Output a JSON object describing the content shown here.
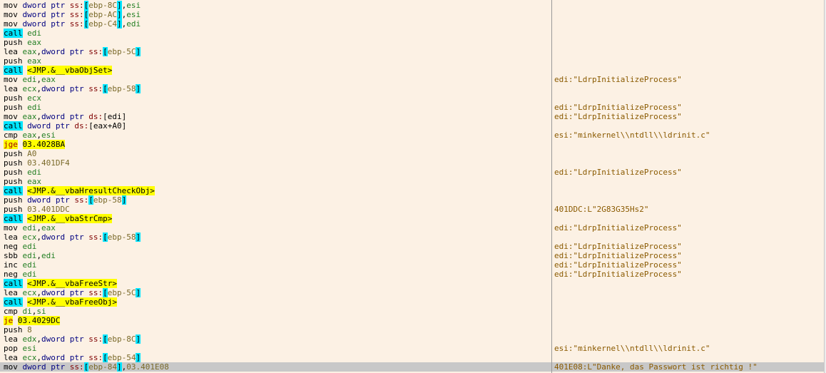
{
  "rows": [
    {
      "tokens": [
        {
          "t": "mov ",
          "k": "default"
        },
        {
          "t": "dword ptr ",
          "k": "size"
        },
        {
          "t": "ss:",
          "k": "segment"
        },
        {
          "t": "[",
          "k": "bracket"
        },
        {
          "t": "ebp-8C",
          "k": "immediate"
        },
        {
          "t": "]",
          "k": "bracket"
        },
        {
          "t": ",",
          "k": "default"
        },
        {
          "t": "esi",
          "k": "register"
        }
      ],
      "comment": ""
    },
    {
      "tokens": [
        {
          "t": "mov ",
          "k": "default"
        },
        {
          "t": "dword ptr ",
          "k": "size"
        },
        {
          "t": "ss:",
          "k": "segment"
        },
        {
          "t": "[",
          "k": "bracket"
        },
        {
          "t": "ebp-AC",
          "k": "immediate"
        },
        {
          "t": "]",
          "k": "bracket"
        },
        {
          "t": ",",
          "k": "default"
        },
        {
          "t": "esi",
          "k": "register"
        }
      ],
      "comment": ""
    },
    {
      "tokens": [
        {
          "t": "mov ",
          "k": "default"
        },
        {
          "t": "dword ptr ",
          "k": "size"
        },
        {
          "t": "ss:",
          "k": "segment"
        },
        {
          "t": "[",
          "k": "bracket"
        },
        {
          "t": "ebp-C4",
          "k": "immediate"
        },
        {
          "t": "]",
          "k": "bracket"
        },
        {
          "t": ",",
          "k": "default"
        },
        {
          "t": "edi",
          "k": "register"
        }
      ],
      "comment": ""
    },
    {
      "tokens": [
        {
          "t": "call",
          "k": "call"
        },
        {
          "t": " ",
          "k": "default"
        },
        {
          "t": "edi",
          "k": "register"
        }
      ],
      "comment": ""
    },
    {
      "tokens": [
        {
          "t": "push ",
          "k": "default"
        },
        {
          "t": "eax",
          "k": "register"
        }
      ],
      "comment": ""
    },
    {
      "tokens": [
        {
          "t": "lea ",
          "k": "default"
        },
        {
          "t": "eax",
          "k": "register"
        },
        {
          "t": ",",
          "k": "default"
        },
        {
          "t": "dword ptr ",
          "k": "size"
        },
        {
          "t": "ss:",
          "k": "segment"
        },
        {
          "t": "[",
          "k": "bracket"
        },
        {
          "t": "ebp-5C",
          "k": "immediate"
        },
        {
          "t": "]",
          "k": "bracket"
        }
      ],
      "comment": ""
    },
    {
      "tokens": [
        {
          "t": "push ",
          "k": "default"
        },
        {
          "t": "eax",
          "k": "register"
        }
      ],
      "comment": ""
    },
    {
      "tokens": [
        {
          "t": "call",
          "k": "call"
        },
        {
          "t": " ",
          "k": "default"
        },
        {
          "t": "<JMP.&__vbaObjSet>",
          "k": "target"
        }
      ],
      "comment": ""
    },
    {
      "tokens": [
        {
          "t": "mov ",
          "k": "default"
        },
        {
          "t": "edi",
          "k": "register"
        },
        {
          "t": ",",
          "k": "default"
        },
        {
          "t": "eax",
          "k": "register"
        }
      ],
      "comment": "edi:\"LdrpInitializeProcess\""
    },
    {
      "tokens": [
        {
          "t": "lea ",
          "k": "default"
        },
        {
          "t": "ecx",
          "k": "register"
        },
        {
          "t": ",",
          "k": "default"
        },
        {
          "t": "dword ptr ",
          "k": "size"
        },
        {
          "t": "ss:",
          "k": "segment"
        },
        {
          "t": "[",
          "k": "bracket"
        },
        {
          "t": "ebp-58",
          "k": "immediate"
        },
        {
          "t": "]",
          "k": "bracket"
        }
      ],
      "comment": ""
    },
    {
      "tokens": [
        {
          "t": "push ",
          "k": "default"
        },
        {
          "t": "ecx",
          "k": "register"
        }
      ],
      "comment": ""
    },
    {
      "tokens": [
        {
          "t": "push ",
          "k": "default"
        },
        {
          "t": "edi",
          "k": "register"
        }
      ],
      "comment": "edi:\"LdrpInitializeProcess\""
    },
    {
      "tokens": [
        {
          "t": "mov ",
          "k": "default"
        },
        {
          "t": "eax",
          "k": "register"
        },
        {
          "t": ",",
          "k": "default"
        },
        {
          "t": "dword ptr ",
          "k": "size"
        },
        {
          "t": "ds:",
          "k": "segment"
        },
        {
          "t": "[edi]",
          "k": "default"
        }
      ],
      "comment": "edi:\"LdrpInitializeProcess\""
    },
    {
      "tokens": [
        {
          "t": "call",
          "k": "call"
        },
        {
          "t": " ",
          "k": "default"
        },
        {
          "t": "dword ptr ",
          "k": "size"
        },
        {
          "t": "ds:",
          "k": "segment"
        },
        {
          "t": "[eax+A0]",
          "k": "default"
        }
      ],
      "comment": ""
    },
    {
      "tokens": [
        {
          "t": "cmp ",
          "k": "default"
        },
        {
          "t": "eax",
          "k": "register"
        },
        {
          "t": ",",
          "k": "default"
        },
        {
          "t": "esi",
          "k": "register"
        }
      ],
      "comment": "esi:\"minkernel\\\\ntdll\\\\ldrinit.c\""
    },
    {
      "tokens": [
        {
          "t": "jge",
          "k": "jump"
        },
        {
          "t": " ",
          "k": "default"
        },
        {
          "t": "03.4028BA",
          "k": "target"
        }
      ],
      "comment": ""
    },
    {
      "tokens": [
        {
          "t": "push ",
          "k": "default"
        },
        {
          "t": "A0",
          "k": "immediate"
        }
      ],
      "comment": ""
    },
    {
      "tokens": [
        {
          "t": "push ",
          "k": "default"
        },
        {
          "t": "03.401DF4",
          "k": "immediate"
        }
      ],
      "comment": ""
    },
    {
      "tokens": [
        {
          "t": "push ",
          "k": "default"
        },
        {
          "t": "edi",
          "k": "register"
        }
      ],
      "comment": "edi:\"LdrpInitializeProcess\""
    },
    {
      "tokens": [
        {
          "t": "push ",
          "k": "default"
        },
        {
          "t": "eax",
          "k": "register"
        }
      ],
      "comment": ""
    },
    {
      "tokens": [
        {
          "t": "call",
          "k": "call"
        },
        {
          "t": " ",
          "k": "default"
        },
        {
          "t": "<JMP.&__vbaHresultCheckObj>",
          "k": "target"
        }
      ],
      "comment": ""
    },
    {
      "tokens": [
        {
          "t": "push ",
          "k": "default"
        },
        {
          "t": "dword ptr ",
          "k": "size"
        },
        {
          "t": "ss:",
          "k": "segment"
        },
        {
          "t": "[",
          "k": "bracket"
        },
        {
          "t": "ebp-58",
          "k": "immediate"
        },
        {
          "t": "]",
          "k": "bracket"
        }
      ],
      "comment": ""
    },
    {
      "tokens": [
        {
          "t": "push ",
          "k": "default"
        },
        {
          "t": "03.401DDC",
          "k": "immediate"
        }
      ],
      "comment": "401DDC:L\"2G83G35Hs2\""
    },
    {
      "tokens": [
        {
          "t": "call",
          "k": "call"
        },
        {
          "t": " ",
          "k": "default"
        },
        {
          "t": "<JMP.&__vbaStrCmp>",
          "k": "target"
        }
      ],
      "comment": ""
    },
    {
      "tokens": [
        {
          "t": "mov ",
          "k": "default"
        },
        {
          "t": "edi",
          "k": "register"
        },
        {
          "t": ",",
          "k": "default"
        },
        {
          "t": "eax",
          "k": "register"
        }
      ],
      "comment": "edi:\"LdrpInitializeProcess\""
    },
    {
      "tokens": [
        {
          "t": "lea ",
          "k": "default"
        },
        {
          "t": "ecx",
          "k": "register"
        },
        {
          "t": ",",
          "k": "default"
        },
        {
          "t": "dword ptr ",
          "k": "size"
        },
        {
          "t": "ss:",
          "k": "segment"
        },
        {
          "t": "[",
          "k": "bracket"
        },
        {
          "t": "ebp-58",
          "k": "immediate"
        },
        {
          "t": "]",
          "k": "bracket"
        }
      ],
      "comment": ""
    },
    {
      "tokens": [
        {
          "t": "neg ",
          "k": "default"
        },
        {
          "t": "edi",
          "k": "register"
        }
      ],
      "comment": "edi:\"LdrpInitializeProcess\""
    },
    {
      "tokens": [
        {
          "t": "sbb ",
          "k": "default"
        },
        {
          "t": "edi",
          "k": "register"
        },
        {
          "t": ",",
          "k": "default"
        },
        {
          "t": "edi",
          "k": "register"
        }
      ],
      "comment": "edi:\"LdrpInitializeProcess\""
    },
    {
      "tokens": [
        {
          "t": "inc ",
          "k": "default"
        },
        {
          "t": "edi",
          "k": "register"
        }
      ],
      "comment": "edi:\"LdrpInitializeProcess\""
    },
    {
      "tokens": [
        {
          "t": "neg ",
          "k": "default"
        },
        {
          "t": "edi",
          "k": "register"
        }
      ],
      "comment": "edi:\"LdrpInitializeProcess\""
    },
    {
      "tokens": [
        {
          "t": "call",
          "k": "call"
        },
        {
          "t": " ",
          "k": "default"
        },
        {
          "t": "<JMP.&__vbaFreeStr>",
          "k": "target"
        }
      ],
      "comment": ""
    },
    {
      "tokens": [
        {
          "t": "lea ",
          "k": "default"
        },
        {
          "t": "ecx",
          "k": "register"
        },
        {
          "t": ",",
          "k": "default"
        },
        {
          "t": "dword ptr ",
          "k": "size"
        },
        {
          "t": "ss:",
          "k": "segment"
        },
        {
          "t": "[",
          "k": "bracket"
        },
        {
          "t": "ebp-5C",
          "k": "immediate"
        },
        {
          "t": "]",
          "k": "bracket"
        }
      ],
      "comment": ""
    },
    {
      "tokens": [
        {
          "t": "call",
          "k": "call"
        },
        {
          "t": " ",
          "k": "default"
        },
        {
          "t": "<JMP.&__vbaFreeObj>",
          "k": "target"
        }
      ],
      "comment": ""
    },
    {
      "tokens": [
        {
          "t": "cmp ",
          "k": "default"
        },
        {
          "t": "di",
          "k": "register"
        },
        {
          "t": ",",
          "k": "default"
        },
        {
          "t": "si",
          "k": "register"
        }
      ],
      "comment": ""
    },
    {
      "tokens": [
        {
          "t": "je",
          "k": "jump"
        },
        {
          "t": " ",
          "k": "default"
        },
        {
          "t": "03.4029DC",
          "k": "target"
        }
      ],
      "comment": ""
    },
    {
      "tokens": [
        {
          "t": "push ",
          "k": "default"
        },
        {
          "t": "8",
          "k": "immediate"
        }
      ],
      "comment": ""
    },
    {
      "tokens": [
        {
          "t": "lea ",
          "k": "default"
        },
        {
          "t": "edx",
          "k": "register"
        },
        {
          "t": ",",
          "k": "default"
        },
        {
          "t": "dword ptr ",
          "k": "size"
        },
        {
          "t": "ss:",
          "k": "segment"
        },
        {
          "t": "[",
          "k": "bracket"
        },
        {
          "t": "ebp-8C",
          "k": "immediate"
        },
        {
          "t": "]",
          "k": "bracket"
        }
      ],
      "comment": ""
    },
    {
      "tokens": [
        {
          "t": "pop ",
          "k": "default"
        },
        {
          "t": "esi",
          "k": "register"
        }
      ],
      "comment": "esi:\"minkernel\\\\ntdll\\\\ldrinit.c\""
    },
    {
      "tokens": [
        {
          "t": "lea ",
          "k": "default"
        },
        {
          "t": "ecx",
          "k": "register"
        },
        {
          "t": ",",
          "k": "default"
        },
        {
          "t": "dword ptr ",
          "k": "size"
        },
        {
          "t": "ss:",
          "k": "segment"
        },
        {
          "t": "[",
          "k": "bracket"
        },
        {
          "t": "ebp-54",
          "k": "immediate"
        },
        {
          "t": "]",
          "k": "bracket"
        }
      ],
      "comment": ""
    },
    {
      "tokens": [
        {
          "t": "mov ",
          "k": "default"
        },
        {
          "t": "dword ptr ",
          "k": "size"
        },
        {
          "t": "ss:",
          "k": "segment"
        },
        {
          "t": "[",
          "k": "bracket"
        },
        {
          "t": "ebp-84",
          "k": "immediate"
        },
        {
          "t": "]",
          "k": "bracket"
        },
        {
          "t": ",",
          "k": "default"
        },
        {
          "t": "03.401E08",
          "k": "immediate"
        }
      ],
      "comment": "401E08:L\"Danke, das Passwort ist richtig !\"",
      "selected": true
    }
  ]
}
